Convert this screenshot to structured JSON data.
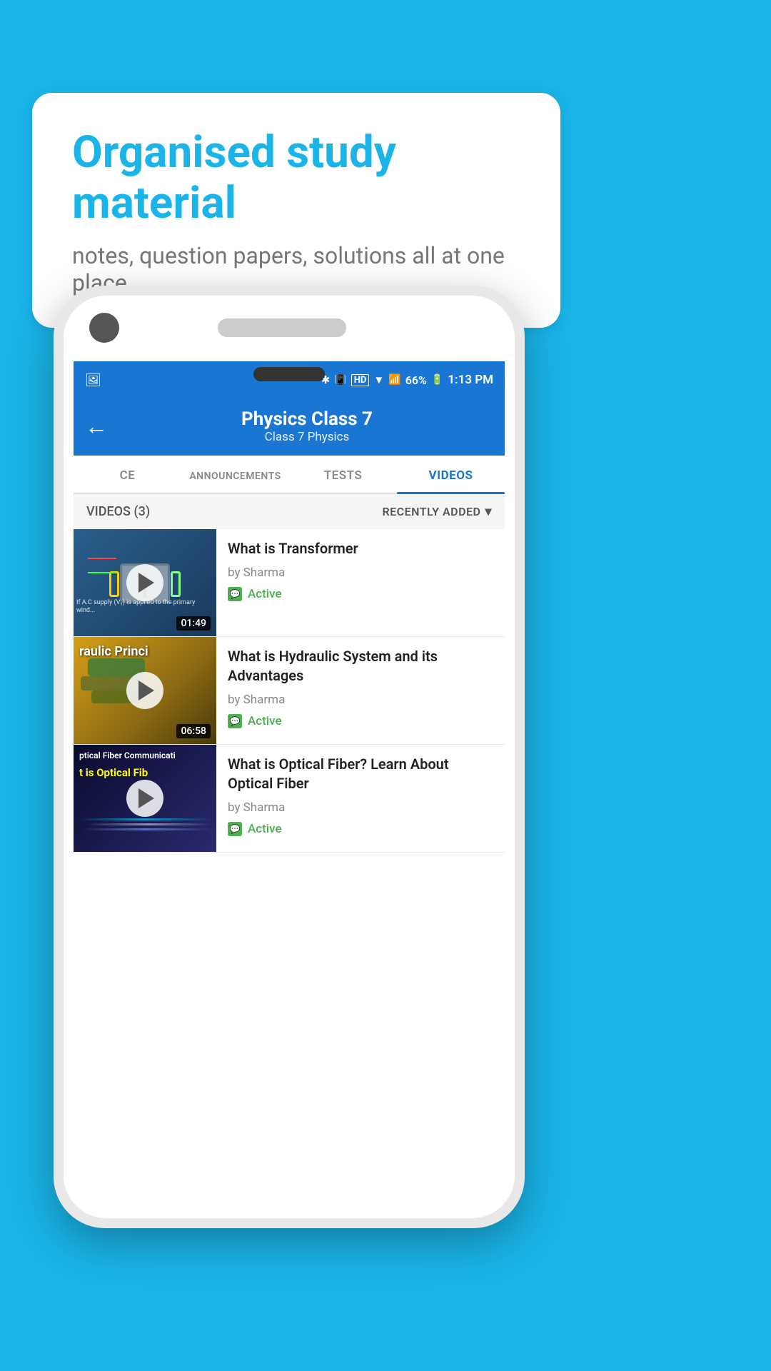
{
  "background_color": "#1ab4e8",
  "speech_bubble": {
    "title": "Organised study material",
    "subtitle": "notes, question papers, solutions all at one place"
  },
  "status_bar": {
    "time": "1:13 PM",
    "battery": "66%",
    "signal_icons": "🔵 ☰ HD ▼"
  },
  "app_bar": {
    "back_label": "←",
    "title": "Physics Class 7",
    "subtitle": "Class 7    Physics"
  },
  "tabs": [
    {
      "label": "CE",
      "active": false
    },
    {
      "label": "ANNOUNCEMENTS",
      "active": false
    },
    {
      "label": "TESTS",
      "active": false
    },
    {
      "label": "VIDEOS",
      "active": true
    }
  ],
  "filter_bar": {
    "count_label": "VIDEOS (3)",
    "sort_label": "RECENTLY ADDED",
    "sort_icon": "chevron-down"
  },
  "videos": [
    {
      "title": "What is  Transformer",
      "author": "by Sharma",
      "status": "Active",
      "duration": "01:49",
      "thumbnail_type": "transformer"
    },
    {
      "title": "What is Hydraulic System and its Advantages",
      "author": "by Sharma",
      "status": "Active",
      "duration": "06:58",
      "thumbnail_type": "hydraulic",
      "thumbnail_text": "raulic Princi"
    },
    {
      "title": "What is Optical Fiber? Learn About Optical Fiber",
      "author": "by Sharma",
      "status": "Active",
      "duration": "",
      "thumbnail_type": "optical",
      "thumbnail_text_top": "ptical Fiber Communicati",
      "thumbnail_text_bottom": "t is Optical Fib"
    }
  ]
}
